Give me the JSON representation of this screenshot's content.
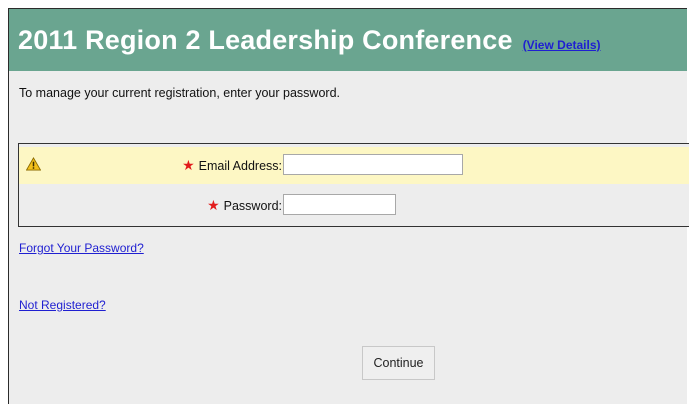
{
  "header": {
    "title": "2011 Region 2 Leadership Conference",
    "details_link": "(View Details)"
  },
  "intro_text": "To manage your current registration, enter your password.",
  "form": {
    "email_label": "Email Address:",
    "email_value": "",
    "password_label": "Password:",
    "password_value": "",
    "required_mark": "★",
    "warning_icon": "warning-triangle"
  },
  "links": {
    "forgot_password": "Forgot Your Password?",
    "not_registered": "Not Registered?"
  },
  "buttons": {
    "continue": "Continue"
  },
  "colors": {
    "header_bg": "#6aa590",
    "highlight_row": "#fdf7c4",
    "link": "#1f1fd1",
    "required": "#e21b1b"
  }
}
